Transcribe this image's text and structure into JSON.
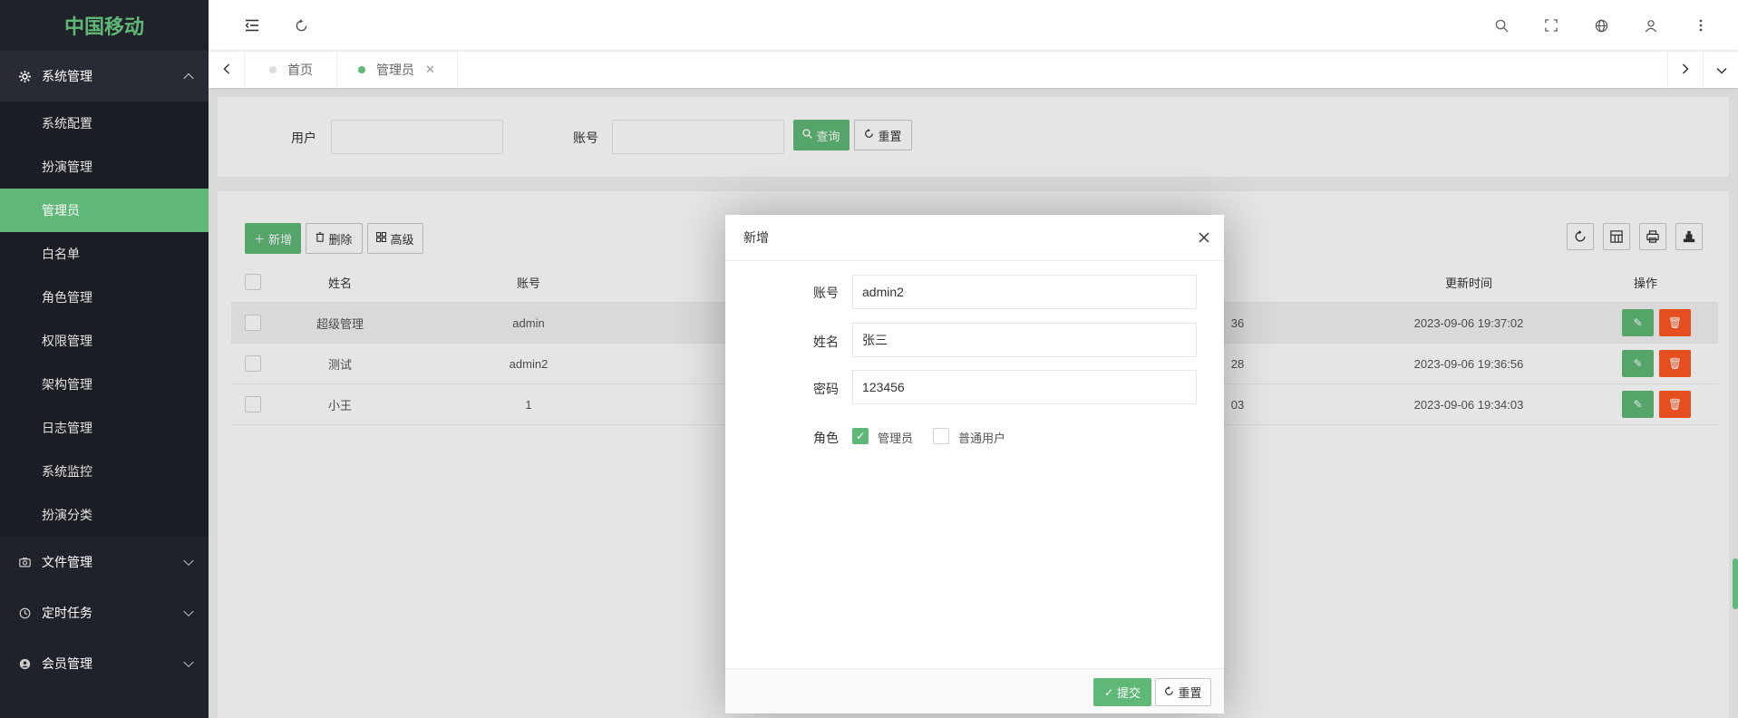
{
  "brand": {
    "logo": "中国移动"
  },
  "sidebar": {
    "groups": [
      {
        "label": "系统管理",
        "icon": "gear-icon",
        "expanded": true,
        "items": [
          {
            "label": "系统配置"
          },
          {
            "label": "扮演管理"
          },
          {
            "label": "管理员",
            "active": true
          },
          {
            "label": "白名单"
          },
          {
            "label": "角色管理"
          },
          {
            "label": "权限管理"
          },
          {
            "label": "架构管理"
          },
          {
            "label": "日志管理"
          },
          {
            "label": "系统监控"
          },
          {
            "label": "扮演分类"
          }
        ]
      },
      {
        "label": "文件管理",
        "icon": "camera-icon",
        "expanded": false
      },
      {
        "label": "定时任务",
        "icon": "clock-icon",
        "expanded": false
      },
      {
        "label": "会员管理",
        "icon": "member-icon",
        "expanded": false
      }
    ]
  },
  "tabs": [
    {
      "label": "首页",
      "active": false
    },
    {
      "label": "管理员",
      "active": true,
      "close": "✕"
    }
  ],
  "search": {
    "user_label": "用户",
    "account_label": "账号",
    "query_button": "查询",
    "reset_button": "重置"
  },
  "toolbar": {
    "add_button": "新增",
    "delete_button": "删除",
    "advanced_button": "高级"
  },
  "table": {
    "columns": {
      "name": "姓名",
      "account": "账号",
      "updated": "更新时间",
      "ops": "操作"
    },
    "rows": [
      {
        "name": "超级管理",
        "account": "admin",
        "partial": "36",
        "updated": "2023-09-06 19:37:02"
      },
      {
        "name": "测试",
        "account": "admin2",
        "partial": "28",
        "updated": "2023-09-06 19:36:56"
      },
      {
        "name": "小王",
        "account": "1",
        "partial": "03",
        "updated": "2023-09-06 19:34:03"
      }
    ]
  },
  "modal": {
    "title": "新增",
    "fields": {
      "account_label": "账号",
      "account_value": "admin2",
      "name_label": "姓名",
      "name_value": "张三",
      "password_label": "密码",
      "password_value": "123456",
      "role_label": "角色"
    },
    "roles": [
      {
        "label": "管理员",
        "checked": true
      },
      {
        "label": "普通用户",
        "checked": false
      }
    ],
    "submit_button": "提交",
    "reset_button": "重置"
  },
  "colors": {
    "accent": "#5fb878",
    "danger": "#ff5722",
    "sidebar": "#20222a"
  }
}
